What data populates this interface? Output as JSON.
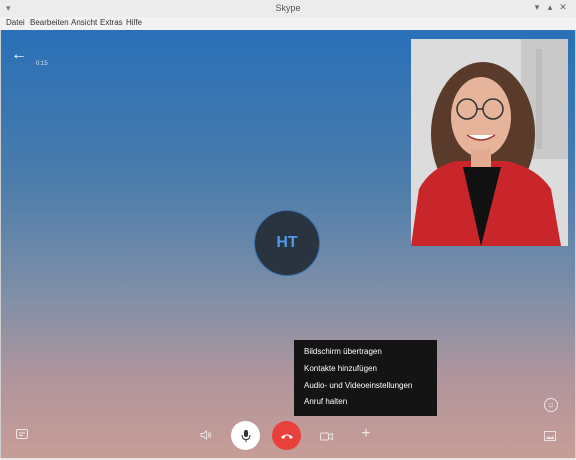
{
  "window": {
    "title": "Skype",
    "sysmenu_glyph": "▾",
    "minimize_glyph": "▾",
    "maximize_glyph": "▴",
    "close_glyph": "✕"
  },
  "menubar": [
    "Datei",
    "Bearbeiten",
    "Ansicht",
    "Extras",
    "Hilfe"
  ],
  "call": {
    "back_glyph": "←",
    "timer": "0:15",
    "avatar_initials": "HT"
  },
  "context_menu": [
    "Bildschirm übertragen",
    "Kontakte hinzufügen",
    "Audio- und Videoeinstellungen",
    "Anruf halten"
  ],
  "controls": {
    "chat_icon": "chat-icon",
    "speaker_icon": "speaker-icon",
    "mic_icon": "microphone-icon",
    "hangup_icon": "hang-up-icon",
    "video_icon": "camera-icon",
    "add_glyph": "+",
    "emoji_icon": "smiley-icon",
    "gallery_icon": "image-icon"
  },
  "colors": {
    "hangup": "#e8413c",
    "mic_bg": "#ffffff",
    "menu_bg": "#141414",
    "avatar_text": "#4f9ae8"
  }
}
